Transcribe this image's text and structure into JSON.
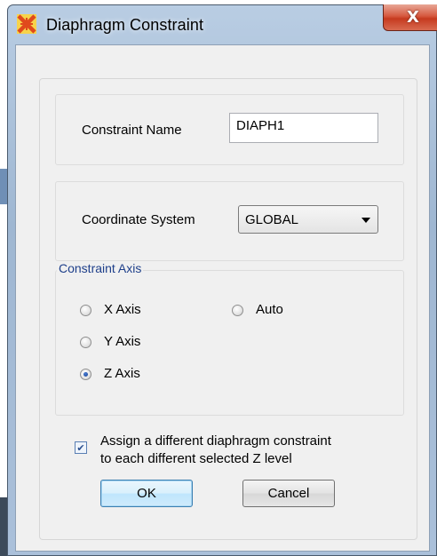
{
  "window": {
    "title": "Diaphragm Constraint",
    "close_glyph": "X"
  },
  "constraint_name": {
    "label": "Constraint Name",
    "value": "DIAPH1"
  },
  "coordinate_system": {
    "label": "Coordinate System",
    "value": "GLOBAL"
  },
  "constraint_axis": {
    "title": "Constraint Axis",
    "options": [
      {
        "label": "X Axis",
        "selected": false
      },
      {
        "label": "Auto",
        "selected": false
      },
      {
        "label": "Y Axis",
        "selected": false
      },
      {
        "label": "Z Axis",
        "selected": true
      }
    ]
  },
  "assign_option": {
    "line1": "Assign a different diaphragm constraint",
    "line2": "to each different selected Z level",
    "checked": true
  },
  "buttons": {
    "ok": "OK",
    "cancel": "Cancel"
  },
  "colors": {
    "accent": "#1e3f8a",
    "close_button": "#c63a1f",
    "icon": "#e04a1c"
  },
  "icons": [
    "app-icon",
    "close-icon",
    "dropdown-arrow-icon",
    "checkmark-icon"
  ]
}
